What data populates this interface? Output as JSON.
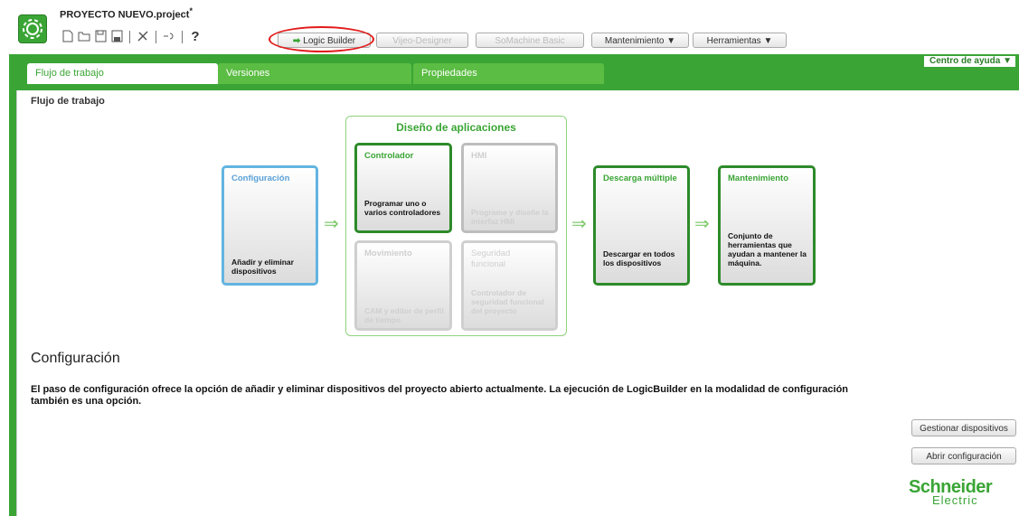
{
  "project": {
    "title": "PROYECTO NUEVO.project",
    "modified_marker": "*"
  },
  "toolbar": {
    "logic_builder": "Logic Builder",
    "vijeo_designer": "Vijeo-Designer",
    "somachine_basic": "SoMachine Basic",
    "mantenimiento": "Mantenimiento ▼",
    "herramientas": "Herramientas ▼",
    "help_symbol": "?"
  },
  "help_center": "Centro de ayuda ▼",
  "tabs": [
    {
      "label": "Flujo de trabajo",
      "active": true
    },
    {
      "label": "Versiones",
      "active": false
    },
    {
      "label": "Propiedades",
      "active": false
    }
  ],
  "section_label": "Flujo de trabajo",
  "workflow": {
    "configuracion": {
      "title": "Configuración",
      "desc": "Añadir y eliminar dispositivos"
    },
    "design_title": "Diseño de aplicaciones",
    "controlador": {
      "title": "Controlador",
      "desc": "Programar uno o varios controladores"
    },
    "hmi": {
      "title": "HMI",
      "desc": "Programe y diseñe la interfaz HMI"
    },
    "movimiento": {
      "title": "Movimiento",
      "desc": "CAM y editor de perfil de tiempo"
    },
    "seguridad": {
      "title": "Seguridad funcional",
      "desc": "Controlador de seguridad funcional del proyecto"
    },
    "descarga": {
      "title": "Descarga múltiple",
      "desc": "Descargar en todos los dispositivos"
    },
    "mantenimiento": {
      "title": "Mantenimiento",
      "desc": "Conjunto de herramientas que ayudan a mantener la máquina."
    },
    "arrow_glyph": "⇒"
  },
  "description": {
    "title": "Configuración",
    "text": "El paso de configuración ofrece la opción de añadir y eliminar dispositivos del proyecto abierto actualmente. La ejecución de LogicBuilder en la modalidad de configuración también es una opción."
  },
  "actions": {
    "gestionar": "Gestionar dispositivos",
    "abrir": "Abrir configuración"
  },
  "brand": {
    "line1": "Schneider",
    "line2": "Electric"
  },
  "colors": {
    "accent": "#3aa535",
    "config_blue": "#63b4e0",
    "highlight_red": "#e21a1a"
  }
}
